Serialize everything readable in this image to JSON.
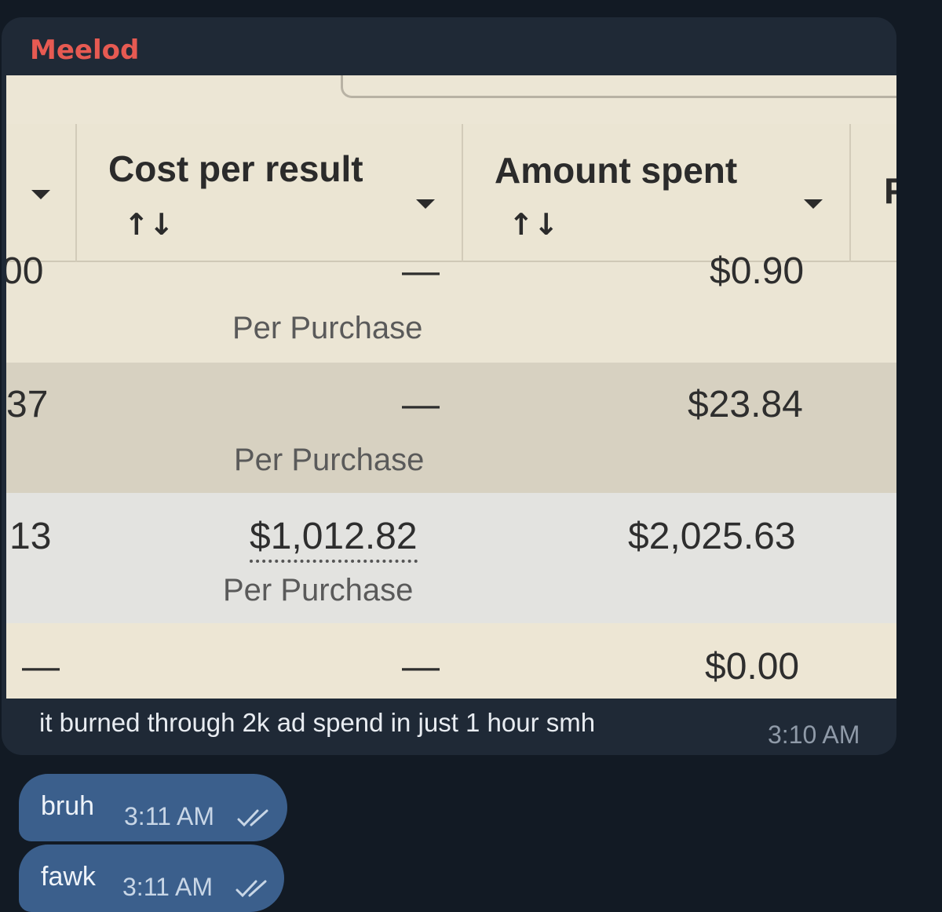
{
  "sender": "Meelod",
  "table": {
    "columns": [
      {
        "title": "Cost per result",
        "sort_icon": "↑↓"
      },
      {
        "title": "Amount spent",
        "sort_icon": "↑↓"
      }
    ],
    "cut_column_letter": "F",
    "rows": [
      {
        "left_partial": "00",
        "cost": "—",
        "cost_sub": "Per Purchase",
        "amount": "$0.90",
        "bg": "#ebe5d4"
      },
      {
        "left_partial": "37",
        "cost": "—",
        "cost_sub": "Per Purchase",
        "amount": "$23.84",
        "bg": "#d7d1c1"
      },
      {
        "left_partial": "13",
        "cost": "$1,012.82",
        "cost_sub": "Per Purchase",
        "amount": "$2,025.63",
        "bg": "#e3e3e0"
      },
      {
        "left_partial": "—",
        "cost": "—",
        "cost_sub": "",
        "amount": "$0.00",
        "bg": "#ede6d4"
      }
    ]
  },
  "caption": "it burned through 2k ad spend in just 1 hour smh",
  "caption_time": "3:10 AM",
  "outgoing": [
    {
      "text": "bruh",
      "time": "3:11 AM",
      "status": "read-double-check-icon"
    },
    {
      "text": "fawk",
      "time": "3:11 AM",
      "status": "read-double-check-icon"
    }
  ],
  "colors": {
    "background": "#121a24",
    "bubble": "#1f2936",
    "outgoing_bubble": "#3b5f8c",
    "sender": "#e65a52"
  }
}
